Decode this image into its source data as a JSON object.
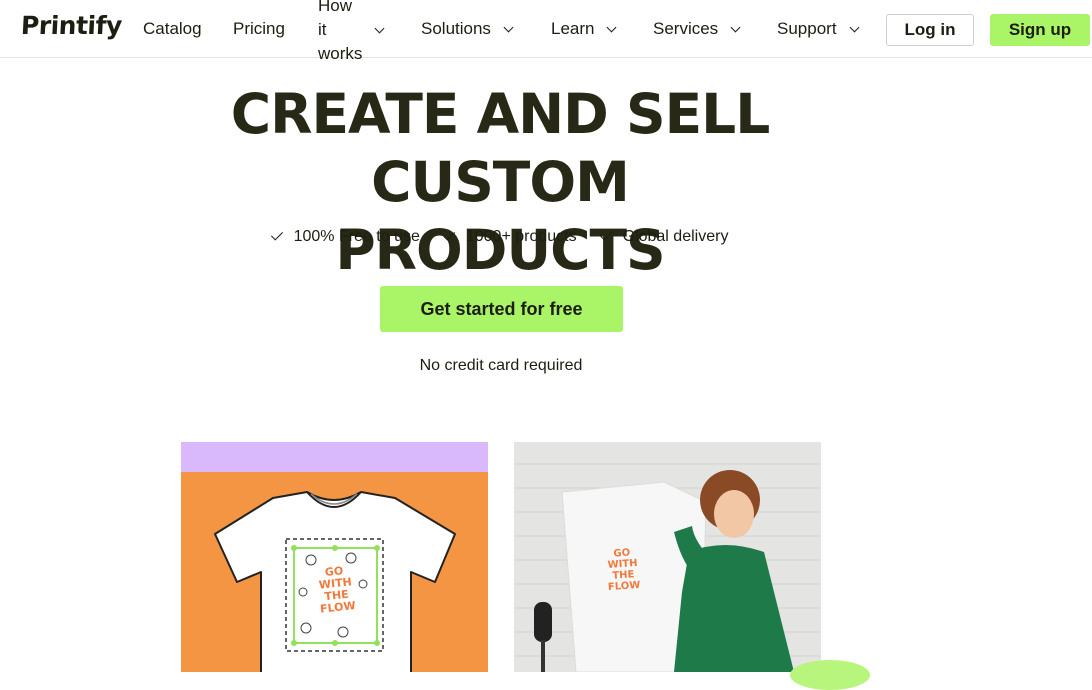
{
  "header": {
    "logo": "Printify",
    "nav": [
      {
        "label": "Catalog"
      },
      {
        "label": "Pricing"
      },
      {
        "label": "How it works",
        "lines": [
          "How",
          "it",
          "works"
        ]
      },
      {
        "label": "Solutions"
      },
      {
        "label": "Learn"
      },
      {
        "label": "Services"
      },
      {
        "label": "Support"
      }
    ],
    "login_label": "Log in",
    "signup_label": "Sign up"
  },
  "hero": {
    "title_line1": "CREATE AND SELL",
    "title_line2": "CUSTOM PRODUCTS",
    "features": [
      "100% Free to use",
      "1000+ products",
      "Global delivery"
    ],
    "cta_label": "Get started for free",
    "note": "No credit card required"
  },
  "artwork": {
    "design_text": [
      "GO",
      "WITH",
      "THE",
      "FLOW"
    ]
  },
  "colors": {
    "accent_green": "#a9f567",
    "card_orange": "#f49544",
    "card_lilac": "#d9b8fb",
    "design_text": "#f07a3b"
  }
}
